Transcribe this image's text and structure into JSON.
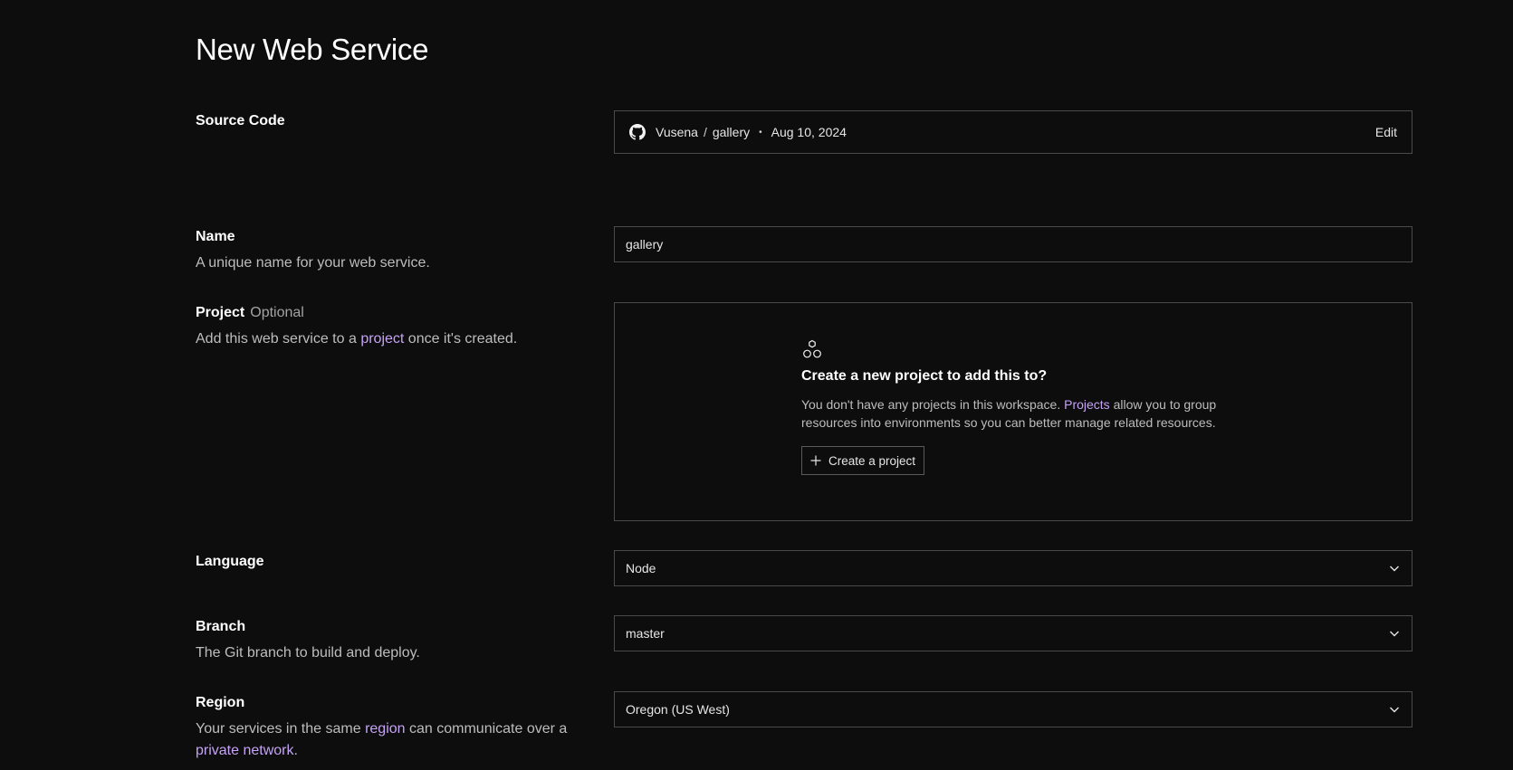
{
  "page": {
    "title": "New Web Service"
  },
  "source_code": {
    "label": "Source Code",
    "owner": "Vusena",
    "separator": "/",
    "repo": "gallery",
    "dot": "•",
    "date": "Aug 10, 2024",
    "edit_label": "Edit",
    "icon": "github-icon"
  },
  "name_field": {
    "label": "Name",
    "description": "A unique name for your web service.",
    "value": "gallery"
  },
  "project_field": {
    "label": "Project",
    "optional": "Optional",
    "desc_before": "Add this web service to a ",
    "desc_link": "project",
    "desc_after": " once it's created.",
    "card": {
      "icon": "project-hexagons-icon",
      "title": "Create a new project to add this to?",
      "desc_before": "You don't have any projects in this workspace. ",
      "desc_link": "Projects",
      "desc_after": " allow you to group resources into environments so you can better manage related resources.",
      "button_label": "Create a project"
    }
  },
  "language_field": {
    "label": "Language",
    "selected": "Node"
  },
  "branch_field": {
    "label": "Branch",
    "description": "The Git branch to build and deploy.",
    "selected": "master"
  },
  "region_field": {
    "label": "Region",
    "desc_before": "Your services in the same ",
    "desc_link1": "region",
    "desc_middle": " can communicate over a ",
    "desc_link2": "private network",
    "desc_after": ".",
    "selected": "Oregon (US West)"
  },
  "colors": {
    "background": "#0d0d0d",
    "border": "#4a4a4a",
    "link": "#c5a3f5",
    "text": "#f2f2f2",
    "muted": "#bdbdbd"
  }
}
